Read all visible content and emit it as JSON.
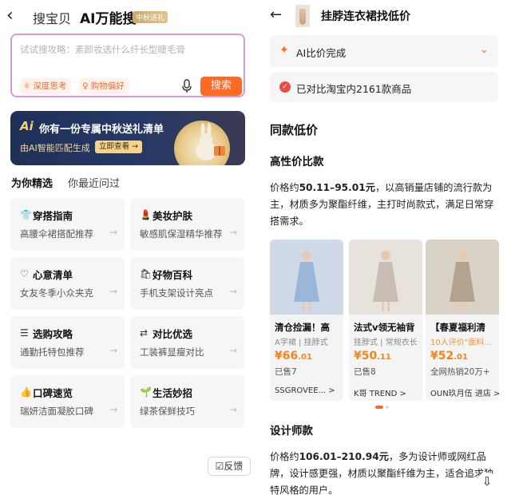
{
  "left": {
    "tabs": [
      "搜宝贝",
      "AI万能搜"
    ],
    "badge": "中秋送礼",
    "search": {
      "placeholder": "试试搜攻略：素颜妆选什么纤长型睫毛膏",
      "chips": [
        "深度思考",
        "购物偏好"
      ],
      "button": "搜索"
    },
    "banner": {
      "logo": "Ai",
      "title": "你有一份专属中秋送礼清单",
      "subtitle": "由AI智能匹配生成",
      "cta": "立即查看 →"
    },
    "section_tabs": [
      "为你精选",
      "你最近问过"
    ],
    "cards": [
      {
        "icon": "shirt-icon",
        "glyph": "👕",
        "title": "穿搭指南",
        "sub": "高腰伞裙搭配推荐"
      },
      {
        "icon": "makeup-icon",
        "glyph": "💄",
        "title": "美妆护肤",
        "sub": "敏感肌保湿精华推荐"
      },
      {
        "icon": "heart-icon",
        "glyph": "♡",
        "title": "心意清单",
        "sub": "女友冬季小众夹克"
      },
      {
        "icon": "bag-icon",
        "glyph": "🛍",
        "title": "好物百科",
        "sub": "手机支架设计亮点"
      },
      {
        "icon": "list-icon",
        "glyph": "☰",
        "title": "选购攻略",
        "sub": "通勤托特包推荐"
      },
      {
        "icon": "compare-icon",
        "glyph": "⇄",
        "title": "对比优选",
        "sub": "工装裤显瘦对比"
      },
      {
        "icon": "thumbs-up-icon",
        "glyph": "👍",
        "title": "口碑速览",
        "sub": "瑞妍洁面凝胶口碑"
      },
      {
        "icon": "leaf-icon",
        "glyph": "🌱",
        "title": "生活妙招",
        "sub": "绿茶保鲜技巧"
      }
    ],
    "feedback": "反馈"
  },
  "right": {
    "title": "挂脖连衣裙找低价",
    "status_done": "AI比价完成",
    "status_compared": "已对比淘宝内2161款商品",
    "h1": "同款低价",
    "h2": "高性价比款",
    "para1_prefix": "价格约",
    "para1_range": "50.11–95.01元",
    "para1_rest": "，以高销量店铺的流行款为主，材质多为聚酯纤维，主打时尚款式，满足日常穿搭需求。",
    "products": [
      {
        "name": "清仓捡漏！高",
        "tags": "A字裙 | 挂脖式",
        "tags_orange": false,
        "price_int": "¥66",
        "price_dec": ".01",
        "sold": "已售7",
        "shop": "SSGROVEE... >",
        "colors": [
          "#cfd9e8",
          "#9ab7d8"
        ]
      },
      {
        "name": "法式v领无袖背",
        "tags": "挂脖式 | 常规衣长",
        "tags_orange": false,
        "price_int": "¥50",
        "price_dec": ".11",
        "sold": "已售8",
        "shop": "K哥 TREND >",
        "colors": [
          "#e8e2dc",
          "#c9bdb3"
        ]
      },
      {
        "name": "【春夏福利清",
        "tags": "10人评价\"面料...",
        "tags_orange": true,
        "price_int": "¥52",
        "price_dec": ".01",
        "sold": "全网热销20万+",
        "shop": "OUN玖月伍 进店 >",
        "colors": [
          "#d9d2c7",
          "#b4a48f"
        ]
      }
    ],
    "h3": "设计师款",
    "para2_prefix": "价格约",
    "para2_range": "106.01–210.94元",
    "para2_rest": "，多为设计师或网红品牌，设计感更强，材质以聚酯纤维为主，适合追求独特风格的用户。"
  }
}
